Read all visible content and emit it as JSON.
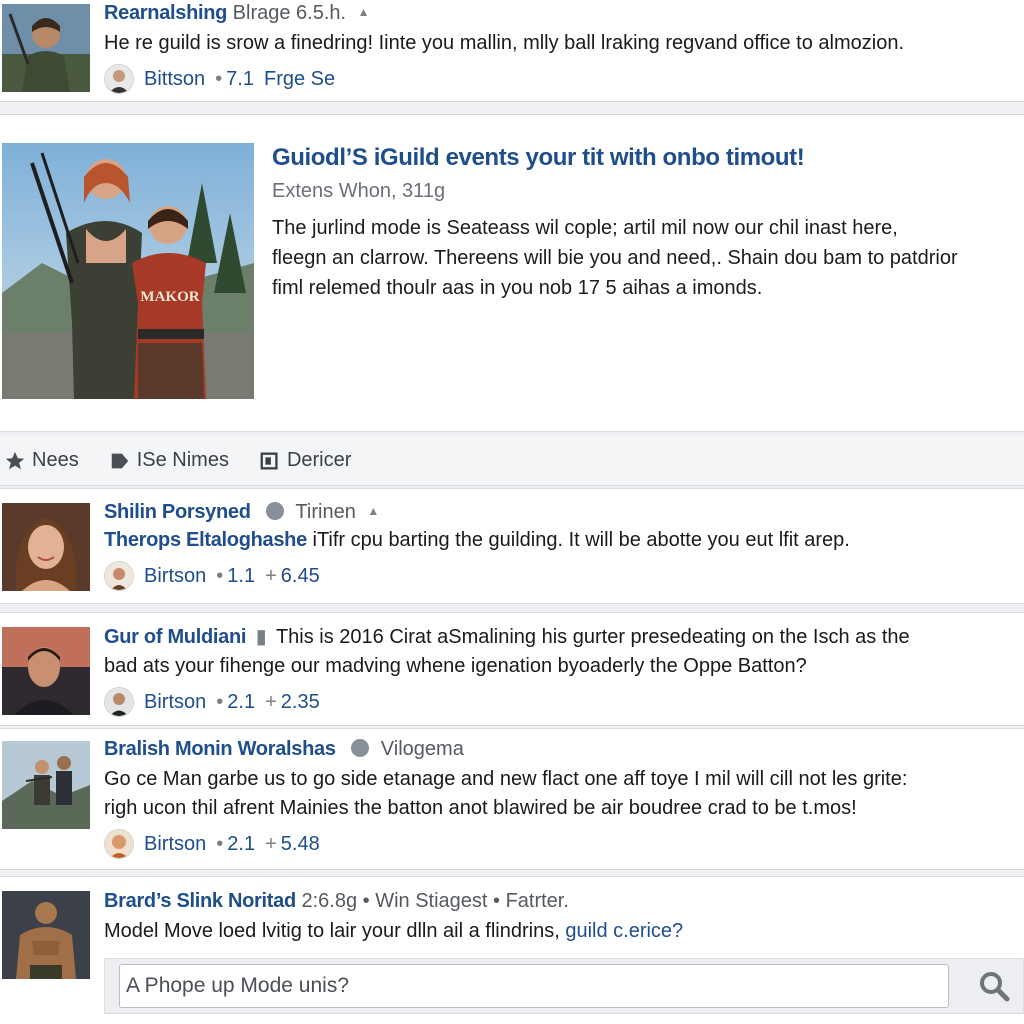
{
  "posts": [
    {
      "author": "Rearnalshing",
      "meta": "Blrage 6.5.h.",
      "text": [
        "He re guild is srow a finedring! Iinte you mallin, mlly ball lraking regvand office to almozion."
      ],
      "footer": {
        "name": "Bittson",
        "score": "7.1",
        "extra": "Frge Se"
      }
    },
    {
      "author": "Shilin Porsyned",
      "meta": "Tirinen",
      "subtitle": "Therops Eltaloghashe",
      "text": [
        "iTifr cpu barting the guilding. It will be abotte you eut lfit arep."
      ],
      "footer": {
        "name": "Birtson",
        "score": "1.1",
        "extra": "6.45"
      }
    },
    {
      "author": "Gur of Muldiani",
      "text": [
        "This is 2016 Cirat aSmalining his gurter presedeating on the Isch as the",
        "bad ats your fihenge our madving whene igenation byoaderly the Oppe Batton?"
      ],
      "footer": {
        "name": "Birtson",
        "score": "2.1",
        "extra": "2.35"
      }
    },
    {
      "author": "Bralish Monin Woralshas",
      "meta": "Vilogema",
      "text": [
        "Go ce Man garbe us to go side etanage and new flact one aff toye I mil will cill not les grite:",
        "righ ucon thil afrent Mainies the batton anot blawired be air boudree crad to be t.mos!"
      ],
      "footer": {
        "name": "Birtson",
        "score": "2.1",
        "extra": "5.48"
      }
    },
    {
      "author": "Brard’s Slink Noritad",
      "meta": "2:6.8g • Win Stiagest • Fatrter.",
      "text_plain": "Model Move loed lvitig to lair your dlln ail a flindrins,",
      "text_link": "guild c.erice?"
    }
  ],
  "featured": {
    "title": "Guiodl’S iGuild events your tit with onbo timout!",
    "subtitle": "Extens Whon, 311g",
    "text": [
      "The jurlind mode is Seateass wil cople; artil mil now our chil inast here,",
      "fleegn an clarrow. Thereens will bie you and need,. Shain dou bam to patdrior",
      "fiml relemed thoulr aas in you nob 17 5 aihas a imonds."
    ],
    "image_label": "MAKOR"
  },
  "tabs": [
    {
      "label": "Nees",
      "icon": "star-icon"
    },
    {
      "label": "ISe Nimes",
      "icon": "tag-icon"
    },
    {
      "label": "Dericer",
      "icon": "document-icon"
    }
  ],
  "reply": {
    "placeholder": "A Phope up Mode unis?"
  },
  "icons": {
    "search": "magnifier-icon"
  },
  "colors": {
    "accent": "#1f4e8c",
    "background": "#eef0f3",
    "card": "#ffffff"
  }
}
